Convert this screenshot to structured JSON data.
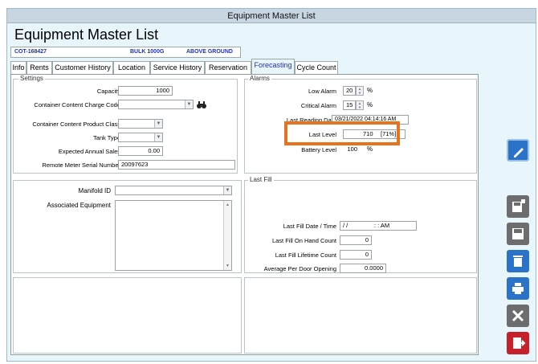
{
  "window": {
    "title": "Equipment Master List"
  },
  "app": {
    "title": "Equipment Master List"
  },
  "infobar": {
    "id": "COT-168427",
    "type": "BULK 1000G",
    "location": "ABOVE GROUND"
  },
  "tabs": [
    {
      "label": "Info"
    },
    {
      "label": "Rents"
    },
    {
      "label": "Customer History"
    },
    {
      "label": "Location"
    },
    {
      "label": "Service History"
    },
    {
      "label": "Reservation"
    },
    {
      "label": "Forecasting"
    },
    {
      "label": "Cycle Count"
    }
  ],
  "settings": {
    "title": "Settings",
    "capacity_label": "Capacity",
    "capacity_value": "1000",
    "charge_code_label": "Container Content Charge Code",
    "charge_code_value": "",
    "product_class_label": "Container Content Product Class",
    "product_class_value": "",
    "tank_type_label": "Tank Type",
    "tank_type_value": "",
    "annual_sales_label": "Expected Annual Sales",
    "annual_sales_value": "0.00",
    "serial_label": "Remote Meter Serial Number",
    "serial_value": "20097623"
  },
  "manifold": {
    "label": "Manifold ID",
    "value": "",
    "assoc_label": "Associated Equipment"
  },
  "alarms": {
    "title": "Alarms",
    "low_label": "Low Alarm",
    "low_value": "20",
    "critical_label": "Critical Alarm",
    "critical_value": "15",
    "pct_unit": "%",
    "last_reading_label": "Last Reading Date",
    "last_reading_value": "03/21/2022 04:14:16 AM",
    "last_level_label": "Last Level",
    "last_level_value": "710",
    "last_level_pct": "[71%]",
    "battery_label": "Battery Level",
    "battery_value": "100"
  },
  "lastfill": {
    "title": "Last Fill",
    "date_label": "Last Fill Date / Time",
    "date_value": "/ /",
    "time_value": ": :   AM",
    "onhand_label": "Last Fill On Hand Count",
    "onhand_value": "0",
    "lifetime_label": "Last Fill Lifetime Count",
    "lifetime_value": "0",
    "avg_label": "Average Per Door Opening",
    "avg_value": "0.0000"
  },
  "colors": {
    "accent": "#2b73c8",
    "highlight": "#e8731f",
    "exit": "#c8202a",
    "gray_btn": "#6d6d6d"
  }
}
